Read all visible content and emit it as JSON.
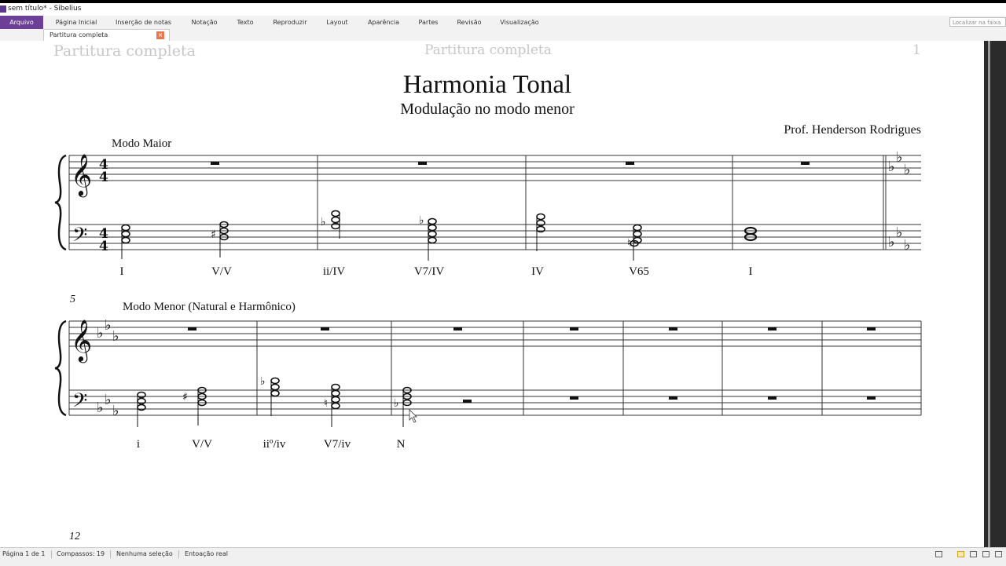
{
  "window": {
    "title": "sem título* - Sibelius"
  },
  "ribbon": {
    "tabs": [
      {
        "label": "Arquivo",
        "active": true
      },
      {
        "label": "Página Inicial"
      },
      {
        "label": "Inserção de notas"
      },
      {
        "label": "Notação"
      },
      {
        "label": "Texto"
      },
      {
        "label": "Reproduzir"
      },
      {
        "label": "Layout"
      },
      {
        "label": "Aparência"
      },
      {
        "label": "Partes"
      },
      {
        "label": "Revisão"
      },
      {
        "label": "Visualização"
      }
    ],
    "search_placeholder": "Localizar na faixa"
  },
  "doc_tab": {
    "label": "Partitura completa"
  },
  "score": {
    "running_header_left": "Partitura completa",
    "running_header_center": "Partitura completa",
    "page_number": "1",
    "title": "Harmonia Tonal",
    "subtitle": "Modulação no modo menor",
    "composer": "Prof. Henderson Rodrigues",
    "system1": {
      "section_label": "Modo Maior",
      "time_signature": "4/4",
      "roman_numerals": [
        "I",
        "V/V",
        "ii/IV",
        "V7/IV",
        "IV",
        "V65",
        "I"
      ]
    },
    "system2": {
      "measure_number": "5",
      "section_label": "Modo Menor (Natural e Harmônico)",
      "roman_numerals": [
        "i",
        "V/V",
        "iiº/iv",
        "V7/iv",
        "N"
      ]
    },
    "system3": {
      "measure_number": "12"
    }
  },
  "status_bar": {
    "page": "Página 1 de 1",
    "bars": "Compassos: 19",
    "selection": "Nenhuma seleção",
    "pitch": "Entoação real"
  },
  "colors": {
    "accent": "#6d3f97",
    "staff": "#333333",
    "header_ghost": "#c7c7c7"
  }
}
